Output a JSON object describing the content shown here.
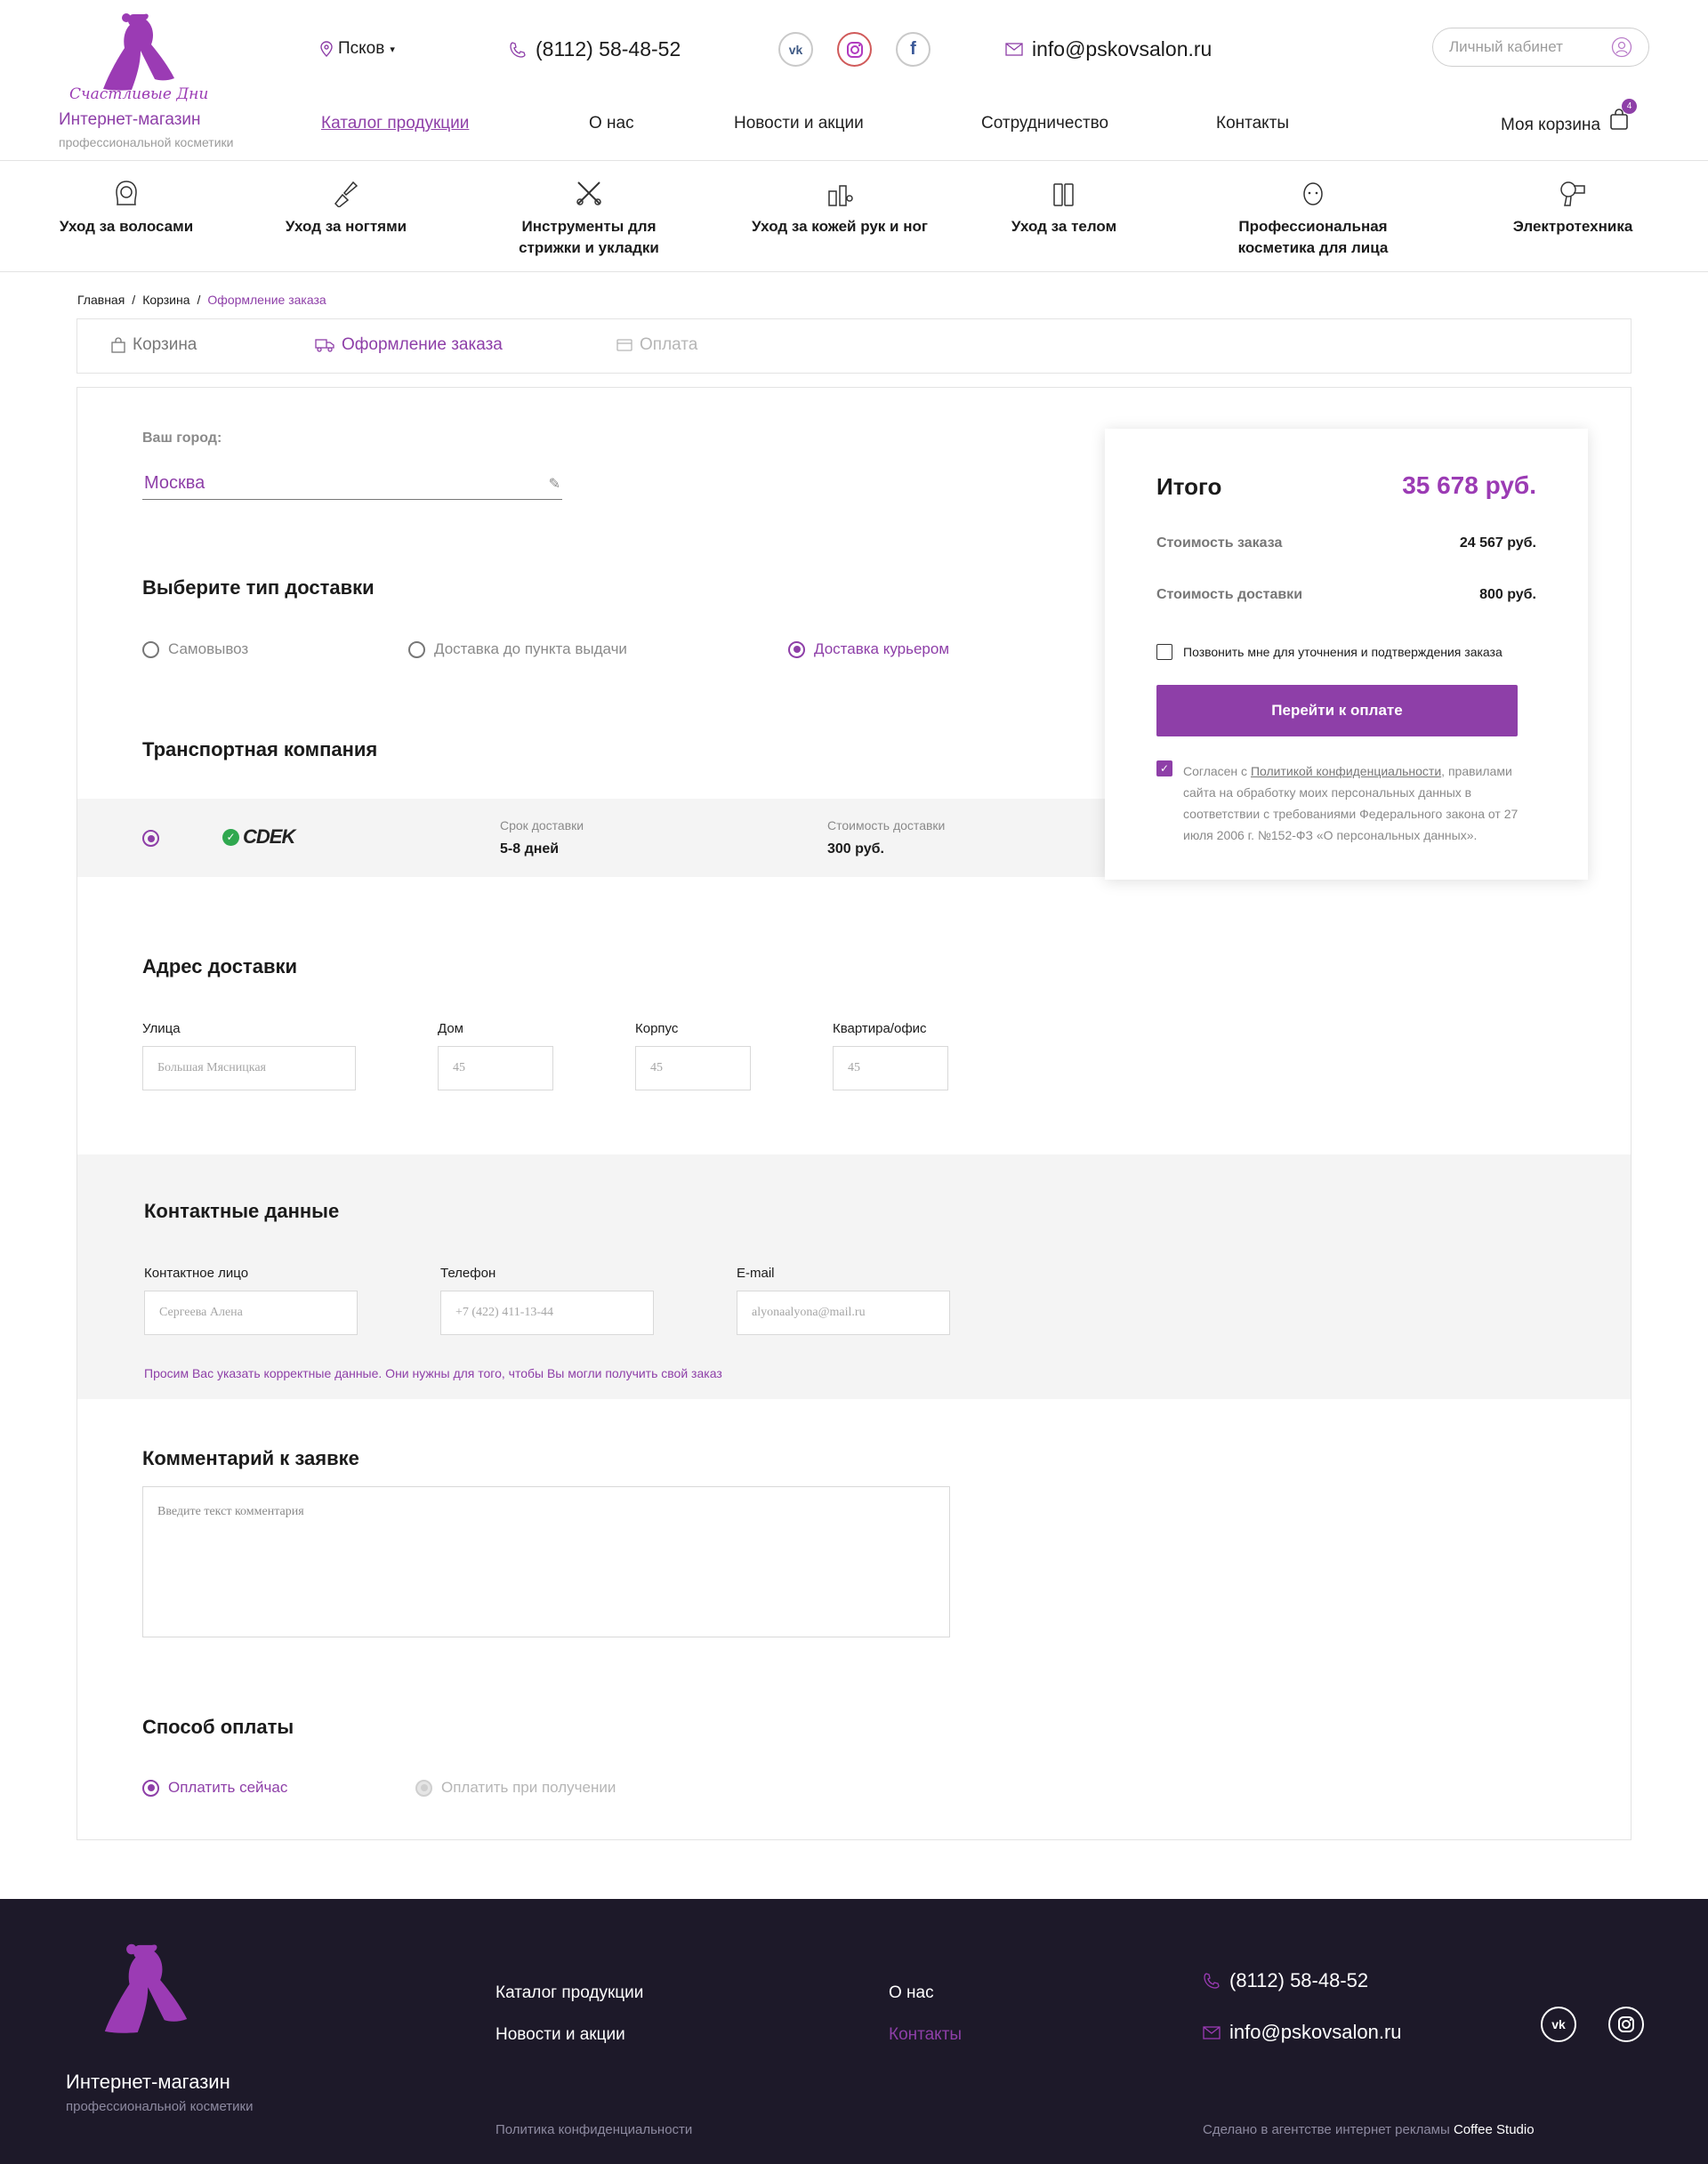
{
  "header": {
    "logo_script": "Счастливые Дни",
    "logo_title": "Интернет-магазин",
    "logo_subtitle": "профессиональной косметики",
    "city": "Псков",
    "phone": "(8112) 58-48-52",
    "email": "info@pskovsalon.ru",
    "login_placeholder": "Личный кабинет",
    "socials": [
      "vk-icon",
      "instagram-icon",
      "facebook-icon"
    ],
    "nav": [
      "Каталог продукции",
      "О нас",
      "Новости и акции",
      "Сотрудничество",
      "Контакты"
    ],
    "cart_label": "Моя корзина",
    "cart_count": "4"
  },
  "categories": [
    {
      "label": "Уход за волосами",
      "icon": "hair-icon"
    },
    {
      "label": "Уход за ногтями",
      "icon": "nail-icon"
    },
    {
      "label": "Инструменты для стрижки и укладки",
      "icon": "scissors-comb-icon"
    },
    {
      "label": "Уход за кожей рук и ног",
      "icon": "skincare-icon"
    },
    {
      "label": "Уход за телом",
      "icon": "bottles-icon"
    },
    {
      "label": "Профессиональная косметика для лица",
      "icon": "face-icon"
    },
    {
      "label": "Электротехника",
      "icon": "hair-dryer-icon"
    }
  ],
  "breadcrumb": [
    "Главная",
    "Корзина",
    "Оформление заказа"
  ],
  "steps": [
    "Корзина",
    "Оформление заказа",
    "Оплата"
  ],
  "city_block": {
    "label": "Ваш город:",
    "value": "Москва"
  },
  "delivery": {
    "title": "Выберите тип доставки",
    "options": [
      "Самовывоз",
      "Доставка до пункта выдачи",
      "Доставка курьером"
    ],
    "selected": 2
  },
  "transport": {
    "title": "Транспортная компания",
    "company": "CDEK",
    "term_label": "Срок доставки",
    "term_value": "5-8 дней",
    "cost_label": "Стоимость доставки",
    "cost_value": "300 руб."
  },
  "address": {
    "title": "Адрес доставки",
    "fields": [
      {
        "label": "Улица",
        "placeholder": "Большая Мясницкая"
      },
      {
        "label": "Дом",
        "placeholder": "45"
      },
      {
        "label": "Корпус",
        "placeholder": "45"
      },
      {
        "label": "Квартира/офис",
        "placeholder": "45"
      }
    ]
  },
  "contacts": {
    "title": "Контактные данные",
    "fields": [
      {
        "label": "Контактное лицо",
        "placeholder": "Сергеева Алена"
      },
      {
        "label": "Телефон",
        "placeholder": "+7 (422) 411-13-44"
      },
      {
        "label": "E-mail",
        "placeholder": "alyonaalyona@mail.ru"
      }
    ],
    "note": "Просим Вас указать корректные данные. Они нужны для того, чтобы Вы могли получить свой заказ"
  },
  "comment": {
    "title": "Комментарий к заявке",
    "placeholder": "Введите текст комментария"
  },
  "payment": {
    "title": "Способ оплаты",
    "options": [
      "Оплатить сейчас",
      "Оплатить при получении"
    ]
  },
  "summary": {
    "title": "Итого",
    "total": "35 678 руб.",
    "order_label": "Стоимость заказа",
    "order_value": "24 567 руб.",
    "delivery_label": "Стоимость доставки",
    "delivery_value": "800 руб.",
    "call_me": "Позвонить мне для уточнения и подтверждения заказа",
    "button": "Перейти к оплате",
    "consent_prefix": "Согласен с ",
    "consent_link": "Политикой конфиденциальности",
    "consent_rest": ", правилами сайта на обработку моих персональных данных в соответствии с требованиями Федерального закона от 27 июля 2006 г. №152-ФЗ «О персональных данных»."
  },
  "footer": {
    "logo_title": "Интернет-магазин",
    "logo_subtitle": "профессиональной косметики",
    "links": [
      "Каталог продукции",
      "Новости и акции",
      "О нас",
      "Контакты"
    ],
    "phone": "(8112) 58-48-52",
    "email": "info@pskovsalon.ru",
    "policy": "Политика конфиденциальности",
    "made_by": "Сделано в агентстве интернет рекламы ",
    "studio": "Coffee Studio"
  },
  "colors": {
    "accent": "#8e3fa8",
    "footer_bg": "#1d1929"
  }
}
